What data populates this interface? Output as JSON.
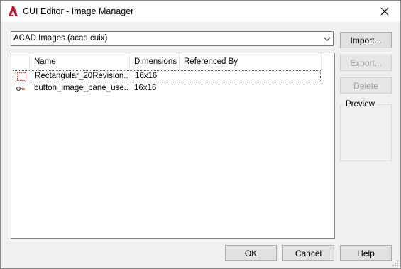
{
  "window": {
    "title": "CUI Editor - Image Manager"
  },
  "combo": {
    "value": "ACAD Images (acad.cuix)"
  },
  "list": {
    "columns": [
      "Name",
      "Dimensions",
      "Referenced By"
    ],
    "rows": [
      {
        "icon": "dotted-rectangle-icon",
        "name": "Rectangular_20Revision...",
        "dimensions": "16x16",
        "referenced_by": ""
      },
      {
        "icon": "key-icon",
        "name": "button_image_pane_use...",
        "dimensions": "16x16",
        "referenced_by": ""
      }
    ]
  },
  "buttons": {
    "import": "Import...",
    "export": "Export...",
    "delete": "Delete",
    "ok": "OK",
    "cancel": "Cancel",
    "help": "Help"
  },
  "preview": {
    "label": "Preview"
  },
  "colors": {
    "app_icon": "#c8102e"
  }
}
